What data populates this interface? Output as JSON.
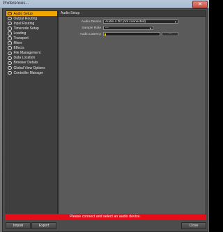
{
  "window": {
    "title": "Preferences...",
    "close_glyph": "✕"
  },
  "sidebar": {
    "items": [
      {
        "label": "Audio Setup",
        "active": true
      },
      {
        "label": "Output Routing"
      },
      {
        "label": "Input Routing"
      },
      {
        "label": "Timecode Setup"
      },
      {
        "label": "Loading"
      },
      {
        "label": "Transport"
      },
      {
        "label": "Mixer"
      },
      {
        "label": "Effects"
      },
      {
        "label": "File Management"
      },
      {
        "label": "Data Location"
      },
      {
        "label": "Browser Details"
      },
      {
        "label": "Global View Options"
      },
      {
        "label": "Controller Manager"
      }
    ]
  },
  "panel": {
    "header": "Audio Setup",
    "audio_device_label": "Audio Device",
    "audio_device_value": "Audio 4 DJ (not connected)",
    "sample_rate_label": "Sample Rate",
    "sample_rate_value": "---",
    "audio_latency_label": "Audio Latency",
    "audio_latency_value": "---",
    "audio_latency_level": 0.03
  },
  "status": {
    "message": "Please connect and select an audio device."
  },
  "buttons": {
    "import": "Import",
    "export": "Export",
    "close": "Close"
  },
  "colors": {
    "accent": "#f0a500",
    "status_error": "#e60d18"
  }
}
